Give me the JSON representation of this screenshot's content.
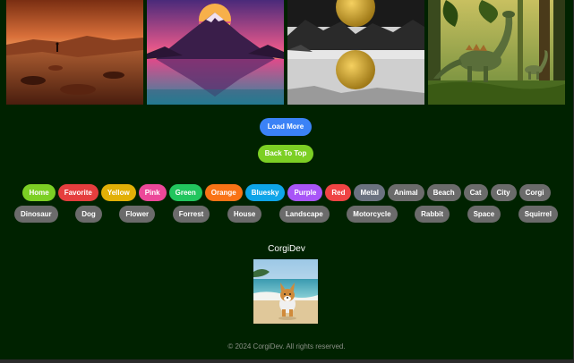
{
  "gallery": {
    "images": [
      {
        "name": "mars-landscape-image"
      },
      {
        "name": "synthwave-mountain-image"
      },
      {
        "name": "golden-moon-ink-landscape-image"
      },
      {
        "name": "dinosaur-forest-image"
      }
    ]
  },
  "actions": {
    "load_more": "Load More",
    "back_to_top": "Back To Top"
  },
  "tags": {
    "row1": [
      {
        "label": "Home",
        "color": "#7ccf24"
      },
      {
        "label": "Favorite",
        "color": "#e53e3e"
      },
      {
        "label": "Yellow",
        "color": "#e2b007"
      },
      {
        "label": "Pink",
        "color": "#ec4899"
      },
      {
        "label": "Green",
        "color": "#22c55e"
      },
      {
        "label": "Orange",
        "color": "#f97316"
      },
      {
        "label": "Bluesky",
        "color": "#0ea5e9"
      },
      {
        "label": "Purple",
        "color": "#a855f7"
      },
      {
        "label": "Red",
        "color": "#ef4444"
      },
      {
        "label": "Metal",
        "color": "#6b7280"
      },
      {
        "label": "Animal",
        "color": "#6b6b6b"
      },
      {
        "label": "Beach",
        "color": "#6b6b6b"
      },
      {
        "label": "Cat",
        "color": "#6b6b6b"
      },
      {
        "label": "City",
        "color": "#6b6b6b"
      },
      {
        "label": "Corgi",
        "color": "#6b6b6b"
      }
    ],
    "row2": [
      {
        "label": "Dinosaur",
        "color": "#6b6b6b"
      },
      {
        "label": "Dog",
        "color": "#6b6b6b"
      },
      {
        "label": "Flower",
        "color": "#6b6b6b"
      },
      {
        "label": "Forrest",
        "color": "#6b6b6b"
      },
      {
        "label": "House",
        "color": "#6b6b6b"
      },
      {
        "label": "Landscape",
        "color": "#6b6b6b"
      },
      {
        "label": "Motorcycle",
        "color": "#6b6b6b"
      },
      {
        "label": "Rabbit",
        "color": "#6b6b6b"
      },
      {
        "label": "Space",
        "color": "#6b6b6b"
      },
      {
        "label": "Squirrel",
        "color": "#6b6b6b"
      }
    ]
  },
  "brand": {
    "name": "CorgiDev",
    "logo": "corgi-beach-logo"
  },
  "footer": {
    "copyright": "© 2024 CorgiDev. All rights reserved."
  },
  "colors": {
    "page_bg": "#002200",
    "load_more": "#3b82f6",
    "back_to_top": "#7ccf24"
  }
}
